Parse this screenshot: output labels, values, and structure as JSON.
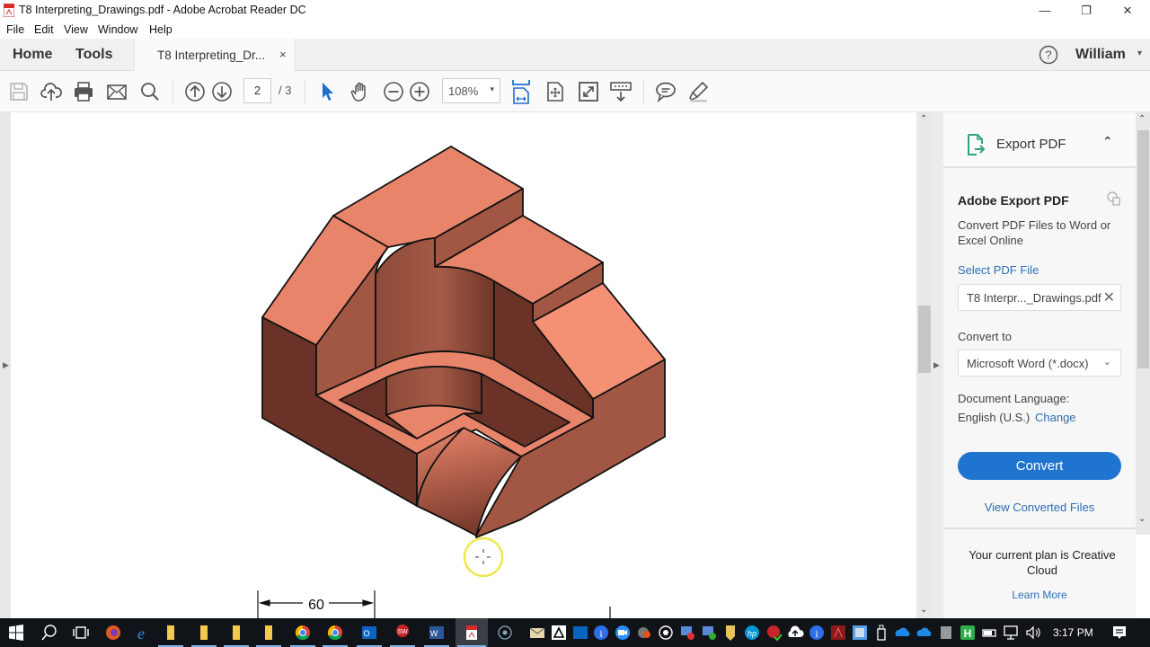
{
  "window": {
    "title": "T8   Interpreting_Drawings.pdf - Adobe Acrobat Reader DC",
    "minimize": "—",
    "restore": "❐",
    "close": "✕"
  },
  "menu": [
    "File",
    "Edit",
    "View",
    "Window",
    "Help"
  ],
  "tabs": {
    "home": "Home",
    "tools": "Tools",
    "document": "T8   Interpreting_Dr...",
    "document_close": "×",
    "help_icon": "?",
    "user": "William",
    "user_caret": "▾"
  },
  "toolbar": {
    "icons": [
      "save-icon",
      "upload-cloud-icon",
      "print-icon",
      "email-icon",
      "search-icon",
      "previous-page-icon",
      "next-page-icon",
      "select-pointer-icon",
      "hand-pan-icon",
      "zoom-out-icon",
      "zoom-in-icon",
      "fit-width-icon",
      "fit-page-icon",
      "full-screen-icon",
      "scroll-mode-icon",
      "comment-icon",
      "highlight-icon"
    ],
    "page_current": "2",
    "page_total": "/ 3",
    "zoom_value": "108%",
    "zoom_caret": "▾"
  },
  "document": {
    "dimension_label": "60",
    "drawing": "isometric-3d-part",
    "colors": {
      "top_face": "#e8846a",
      "light_face": "#f49074",
      "mid_face": "#a25744",
      "dark_face": "#6b3328",
      "outline": "#111111"
    }
  },
  "scroll": {
    "up": "⌃",
    "down": "⌄",
    "collapse_left": "▶",
    "collapse_right": "▶"
  },
  "export_panel": {
    "header": "Export PDF",
    "collapse_icon": "⌃",
    "heading": "Adobe Export PDF",
    "description": "Convert PDF Files to Word or Excel Online",
    "select_file_label": "Select PDF File",
    "selected_file": "T8 Interpr..._Drawings.pdf",
    "clear_file": "✕",
    "convert_to_label": "Convert to",
    "convert_to_value": "Microsoft Word (*.docx)",
    "dropdown_caret": "⌄",
    "language_label": "Document Language:",
    "language_value": "English (U.S.)",
    "change_link": "Change",
    "convert_button": "Convert",
    "view_converted": "View Converted Files",
    "plan_text": "Your current plan is Creative Cloud",
    "learn_more": "Learn More",
    "accent_color": "#1f74d0",
    "link_color": "#2d6eb5"
  },
  "taskbar": {
    "icons": [
      "windows-start-icon",
      "search-icon",
      "task-view-icon",
      "firefox-icon",
      "edge-icon",
      "folder-icon",
      "folder-icon",
      "folder-icon",
      "folder-icon",
      "chrome-icon",
      "chrome-icon",
      "outlook-icon",
      "solidworks-icon",
      "word-icon",
      "acrobat-icon",
      "record-icon",
      "mail-icon",
      "drive-icon",
      "outlook-icon",
      "info-icon",
      "zoom-icon",
      "settings-icon",
      "record-icon",
      "network-icon",
      "network-icon",
      "shield-icon",
      "hp-icon",
      "solidworks-icon",
      "upload-icon",
      "info-icon",
      "acrobat-icon",
      "app-icon",
      "usb-icon",
      "onedrive-icon",
      "onedrive-icon",
      "printer-icon",
      "h-icon",
      "power-icon",
      "network-icon",
      "volume-icon"
    ],
    "clock": "3:17 PM",
    "notifications_icon": "notification-icon"
  }
}
